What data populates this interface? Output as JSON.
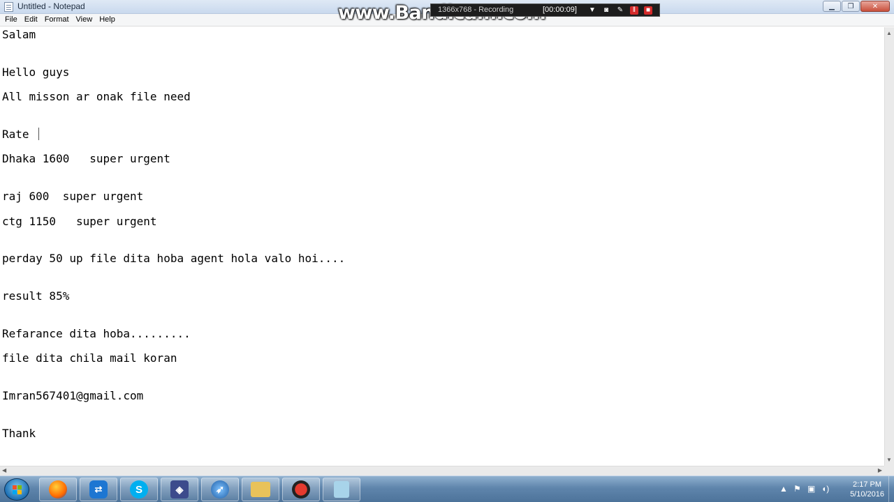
{
  "window": {
    "title": "Untitled - Notepad"
  },
  "window_buttons": {
    "minimize": "▁",
    "maximize": "❐",
    "close": "✕"
  },
  "overlay": {
    "watermark": "www.Bandicam.com",
    "recording_info": "1366x768 - Recording",
    "recording_time": "[00:00:09]"
  },
  "menu": [
    "File",
    "Edit",
    "Format",
    "View",
    "Help"
  ],
  "document": {
    "lines": [
      "Salam",
      "Hello guys",
      "All misson ar onak file need",
      "Rate",
      "Dhaka 1600   super urgent",
      "raj 600  super urgent",
      "ctg 1150   super urgent",
      "perday 50 up file dita hoba agent hola valo hoi....",
      "result 85%",
      "Refarance dita hoba.........",
      "file dita chila mail koran",
      "Imran567401@gmail.com",
      "Thank"
    ]
  },
  "taskbar": {
    "pinned": [
      "firefox-icon",
      "teamviewer-icon",
      "skype-icon",
      "virtualbox-icon",
      "browser-icon",
      "folder-icon",
      "bandicam-icon",
      "notepad-icon"
    ]
  },
  "clock": {
    "time": "2:17 PM",
    "date": "5/10/2016"
  },
  "colors": {
    "title_bar": "#dfe9f5",
    "taskbar": "#5f85ac",
    "close_button": "#c9503c"
  }
}
